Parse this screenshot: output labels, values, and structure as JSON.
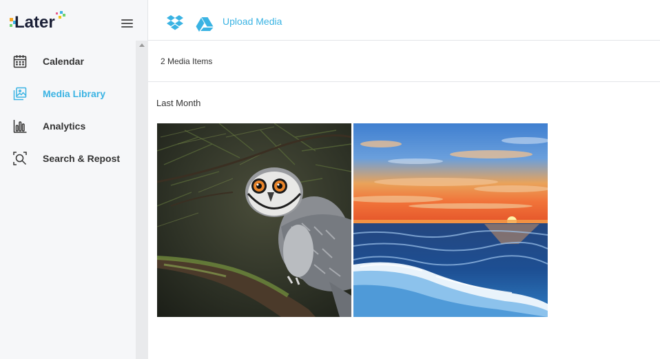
{
  "sidebar": {
    "logo_text": "Later",
    "items": [
      {
        "label": "Calendar",
        "icon": "calendar-icon",
        "active": false
      },
      {
        "label": "Media Library",
        "icon": "media-library-icon",
        "active": true
      },
      {
        "label": "Analytics",
        "icon": "analytics-icon",
        "active": false
      },
      {
        "label": "Search & Repost",
        "icon": "search-repost-icon",
        "active": false
      }
    ]
  },
  "topbar": {
    "upload_label": "Upload Media"
  },
  "library": {
    "count_label": "2 Media Items",
    "section_title": "Last Month"
  },
  "colors": {
    "accent": "#3ab3e3",
    "sidebar_bg": "#f6f7f9"
  }
}
